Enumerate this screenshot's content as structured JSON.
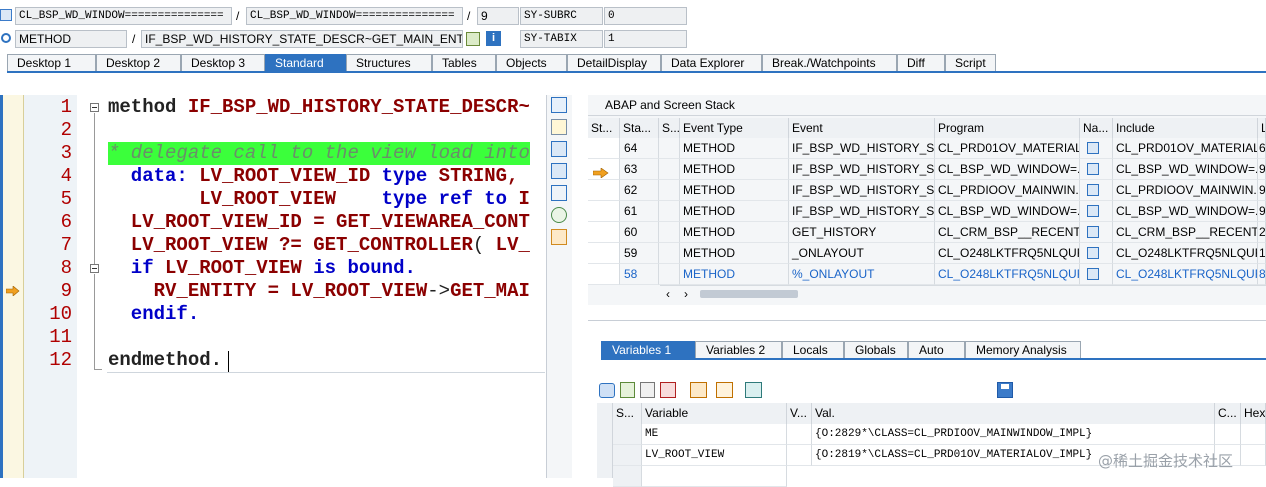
{
  "top": {
    "row1": {
      "field1": "CL_BSP_WD_WINDOW===============",
      "sep1": "/",
      "field2": "CL_BSP_WD_WINDOW===============",
      "sep2": "/",
      "field3": "9",
      "sysfield": "SY-SUBRC",
      "sysval": "0"
    },
    "row2": {
      "field1": "METHOD",
      "sep1": "/",
      "field2": "IF_BSP_WD_HISTORY_STATE_DESCR~GET_MAIN_ENT...",
      "sysfield": "SY-TABIX",
      "sysval": "1"
    }
  },
  "tabs": [
    "Desktop 1",
    "Desktop 2",
    "Desktop 3",
    "Standard",
    "Structures",
    "Tables",
    "Objects",
    "DetailDisplay",
    "Data Explorer",
    "Break./Watchpoints",
    "Diff",
    "Script"
  ],
  "active_tab": "Standard",
  "editor": {
    "line_numbers": [
      "1",
      "2",
      "3",
      "4",
      "5",
      "6",
      "7",
      "8",
      "9",
      "10",
      "11",
      "12"
    ],
    "l1": {
      "a": "method ",
      "b": "IF_BSP_WD_HISTORY_STATE_DESCR~"
    },
    "l3": "* delegate call to the view load into",
    "l4": {
      "a": "  data: ",
      "b": "LV_ROOT_VIEW_ID ",
      "c": "type ",
      "d": "STRING,"
    },
    "l5": {
      "b": "        LV_ROOT_VIEW    ",
      "c": "type ref to ",
      "d": "I"
    },
    "l6": {
      "b": "  LV_ROOT_VIEW_ID = GET_VIEWAREA_CONT"
    },
    "l7": {
      "b": "  LV_ROOT_VIEW ?= GET_CONTROLLER",
      "c": "( ",
      "d": "LV_"
    },
    "l8": {
      "a": "  if ",
      "b": "LV_ROOT_VIEW ",
      "c": "is bound."
    },
    "l9": {
      "b": "    RV_ENTITY = LV_ROOT_VIEW",
      "c": "->",
      "d": "GET_MAI"
    },
    "l10": "  endif.",
    "l12": "endmethod."
  },
  "stack": {
    "title": "ABAP and Screen Stack",
    "columns": [
      "St...",
      "Sta...",
      "S...",
      "Event Type",
      "Event",
      "Program",
      "Na...",
      "Include",
      "L"
    ],
    "rows": [
      {
        "level": "64",
        "type": "METHOD",
        "event": "IF_BSP_WD_HISTORY_S...",
        "program": "CL_PRD01OV_MATERIAL...",
        "include": "CL_PRD01OV_MATERIAL...",
        "line": "6"
      },
      {
        "level": "63",
        "type": "METHOD",
        "event": "IF_BSP_WD_HISTORY_S...",
        "program": "CL_BSP_WD_WINDOW=...",
        "include": "CL_BSP_WD_WINDOW=...",
        "line": "9"
      },
      {
        "level": "62",
        "type": "METHOD",
        "event": "IF_BSP_WD_HISTORY_S...",
        "program": "CL_PRDIOOV_MAINWIN...",
        "include": "CL_PRDIOOV_MAINWIN...",
        "line": "9"
      },
      {
        "level": "61",
        "type": "METHOD",
        "event": "IF_BSP_WD_HISTORY_S...",
        "program": "CL_BSP_WD_WINDOW=...",
        "include": "CL_BSP_WD_WINDOW=...",
        "line": "9"
      },
      {
        "level": "60",
        "type": "METHOD",
        "event": "GET_HISTORY",
        "program": "CL_CRM_BSP__RECENTO...",
        "include": "CL_CRM_BSP__RECENTO...",
        "line": "2"
      },
      {
        "level": "59",
        "type": "METHOD",
        "event": "_ONLAYOUT",
        "program": "CL_O248LKTFRQ5NLQUR...",
        "include": "CL_O248LKTFRQ5NLQUR...",
        "line": "1"
      },
      {
        "level": "58",
        "type": "METHOD",
        "event": "%_ONLAYOUT",
        "program": "CL_O248LKTFRQ5NLQUR...",
        "include": "CL_O248LKTFRQ5NLQUR...",
        "line": "8"
      }
    ]
  },
  "var_tabs": [
    "Variables 1",
    "Variables 2",
    "Locals",
    "Globals",
    "Auto",
    "Memory Analysis"
  ],
  "vars": {
    "columns": [
      "S...",
      "Variable",
      "V...",
      "Val.",
      "C...",
      "Hex"
    ],
    "rows": [
      {
        "name": "ME",
        "value": "{O:2829*\\CLASS=CL_PRDIOOV_MAINWINDOW_IMPL}"
      },
      {
        "name": "LV_ROOT_VIEW",
        "value": "{O:2819*\\CLASS=CL_PRD01OV_MATERIALOV_IMPL}"
      }
    ]
  },
  "watermark": "@稀土掘金技术社区",
  "colors": {
    "accent": "#2e72c0",
    "keyword": "#0000c8",
    "identifier": "#8b0000",
    "comment_bg": "#3bff3b",
    "line_no": "#b00000"
  }
}
